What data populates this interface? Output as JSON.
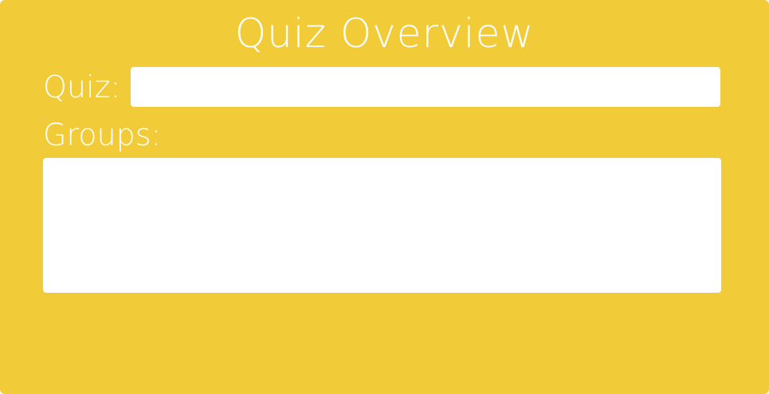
{
  "panel": {
    "title": "Quiz Overview",
    "background_color": "#f1cb38"
  },
  "quiz": {
    "label": "Quiz:",
    "value": "",
    "placeholder": ""
  },
  "groups": {
    "label": "Groups:",
    "value": ""
  }
}
